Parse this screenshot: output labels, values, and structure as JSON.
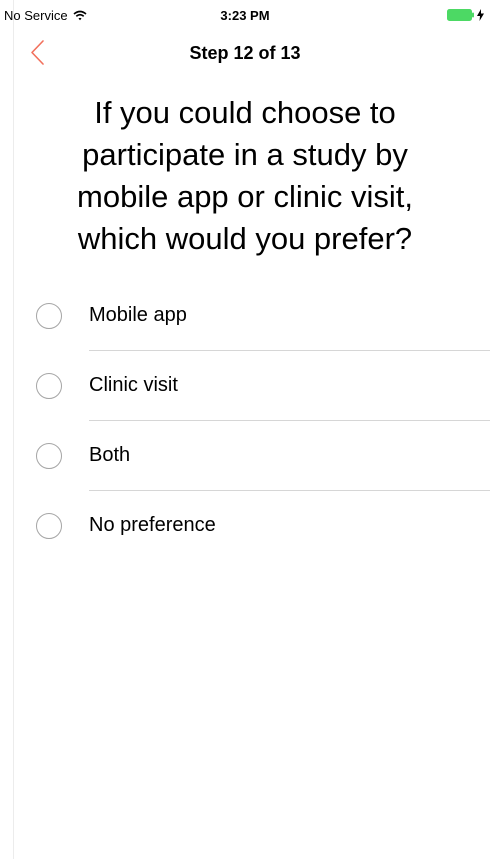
{
  "status_bar": {
    "carrier": "No Service",
    "time": "3:23 PM",
    "icons": {
      "wifi": "wifi-icon",
      "battery": "battery-icon",
      "charging": "bolt-icon"
    },
    "battery_color": "#4cd964"
  },
  "nav": {
    "title": "Step 12 of 13",
    "back_icon": "chevron-left-icon",
    "accent_color": "#f2705c"
  },
  "question": {
    "text": "If you could choose to participate in a study by mobile app or clinic visit, which would you prefer?"
  },
  "choices": [
    {
      "label": "Mobile app",
      "selected": false
    },
    {
      "label": "Clinic visit",
      "selected": false
    },
    {
      "label": "Both",
      "selected": false
    },
    {
      "label": "No preference",
      "selected": false
    }
  ]
}
